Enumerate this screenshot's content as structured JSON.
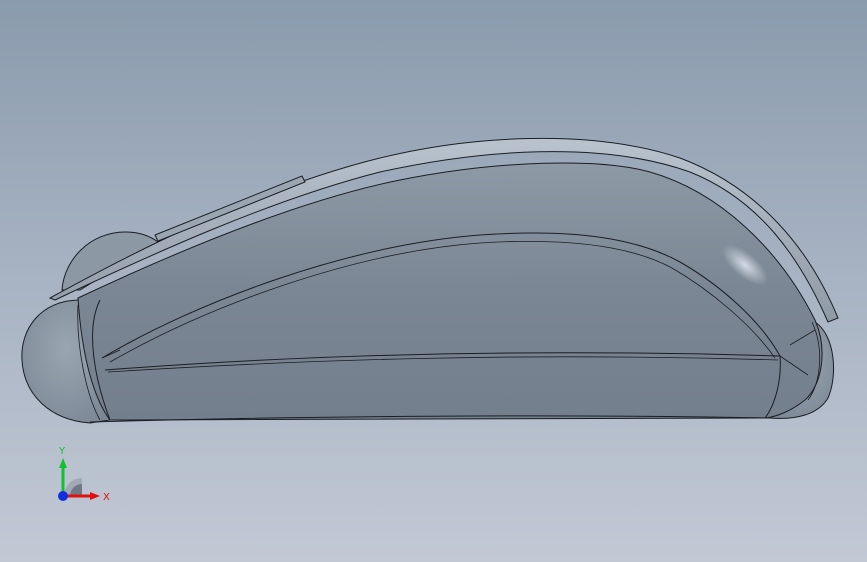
{
  "viewport": {
    "background_top": "#8a9bad",
    "background_bottom": "#c2c9d5"
  },
  "model": {
    "body_color": "#7d8896",
    "edge_color": "#1a1e24",
    "highlight_color": "#c9d2dc"
  },
  "triad": {
    "x_label": "X",
    "y_label": "Y",
    "x_color": "#e01010",
    "y_color": "#10c030",
    "z_color": "#1030e0"
  }
}
